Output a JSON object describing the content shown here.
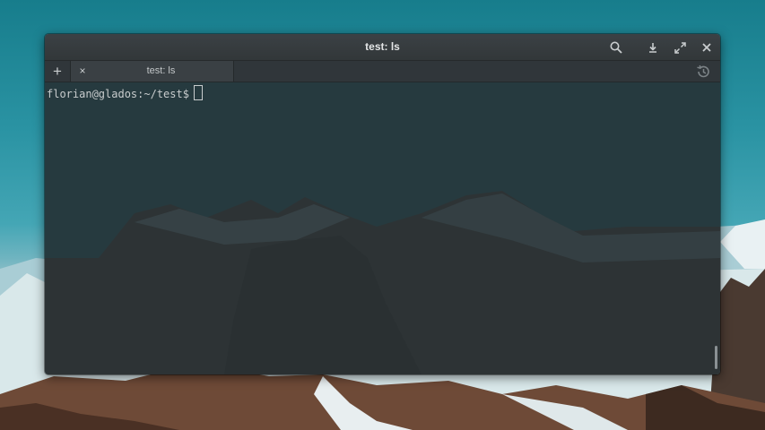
{
  "window": {
    "title": "test: ls"
  },
  "titlebar_icons": [
    "search-icon",
    "download-icon",
    "fullscreen-icon",
    "close-icon"
  ],
  "tabs": {
    "new_tab_label": "+",
    "items": [
      {
        "label": "test: ls",
        "close_label": "×"
      }
    ],
    "history_icon": "history-icon"
  },
  "terminal": {
    "prompt": "florian@glados:~/test$"
  },
  "colors": {
    "titlebar": "#363b3e",
    "terminal_bg": "#252e32",
    "text": "#c8cccd",
    "sky": "#2a93a3"
  }
}
